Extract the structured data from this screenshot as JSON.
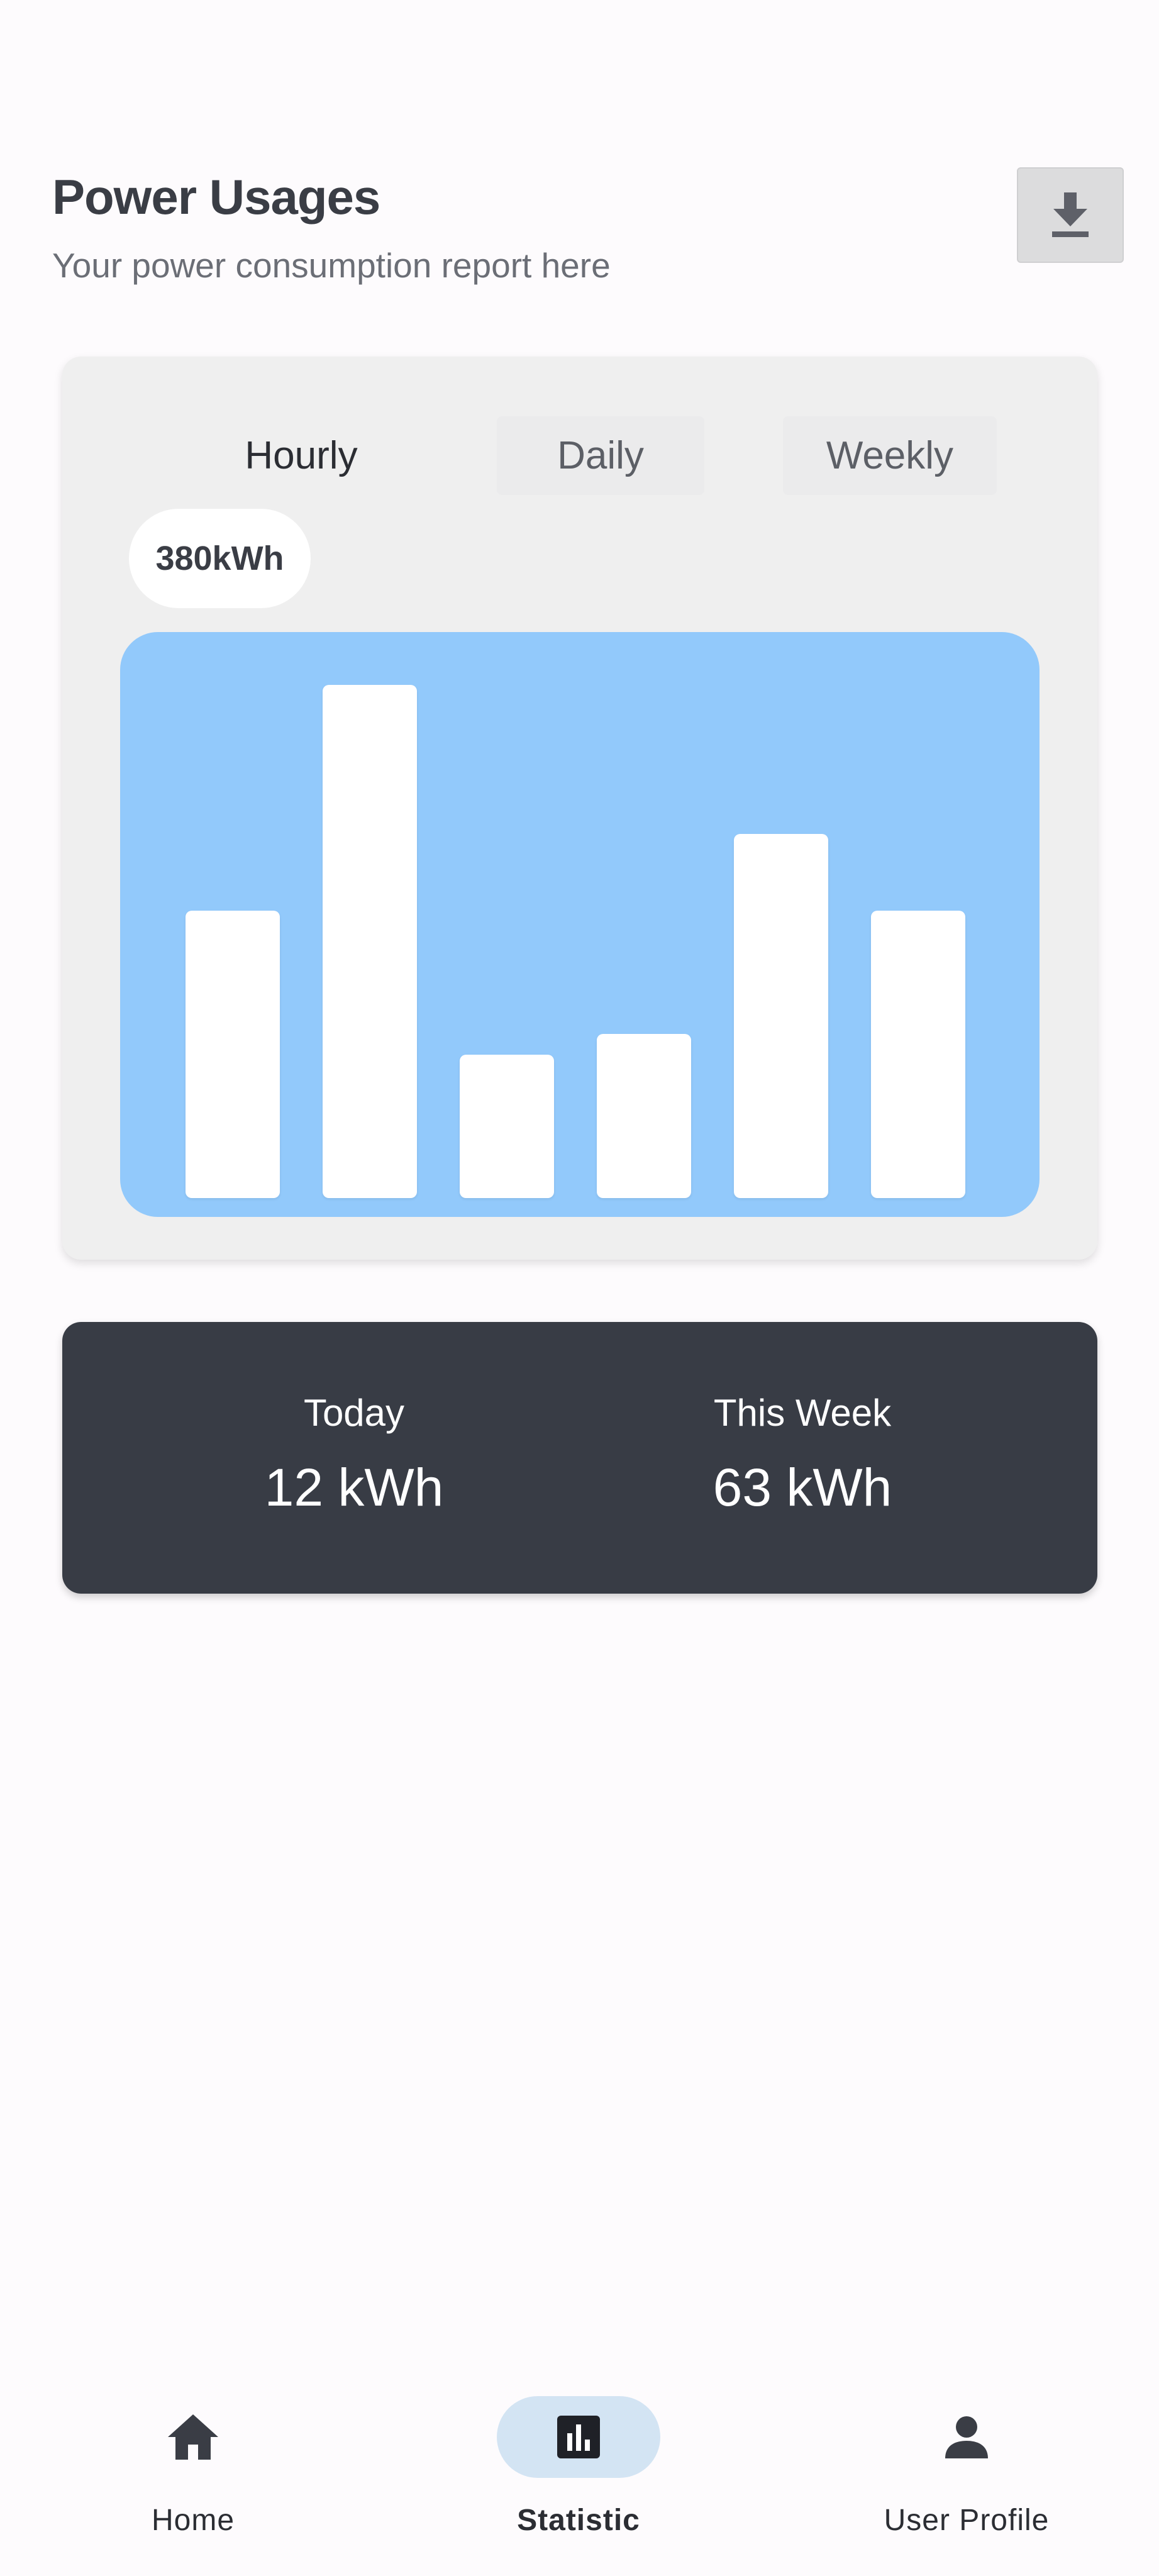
{
  "header": {
    "title": "Power Usages",
    "subtitle": "Your power consumption report here",
    "download_icon": "download-icon"
  },
  "chart_card": {
    "tabs": [
      {
        "label": "Hourly",
        "active": true
      },
      {
        "label": "Daily",
        "active": false
      },
      {
        "label": "Weekly",
        "active": false
      }
    ],
    "selected_value": "380kWh"
  },
  "chart_data": {
    "type": "bar",
    "categories": [
      "",
      "",
      "",
      "",
      "",
      ""
    ],
    "values": [
      0.56,
      1.0,
      0.28,
      0.32,
      0.71,
      0.56
    ],
    "ylim": [
      0,
      1
    ],
    "title": "",
    "xlabel": "",
    "ylabel": "",
    "grid": false,
    "colors": {
      "background": "#92c9fb",
      "bar": "#ffffff"
    }
  },
  "stats": {
    "today_label": "Today",
    "today_value": "12 kWh",
    "week_label": "This Week",
    "week_value": "63 kWh"
  },
  "nav": {
    "items": [
      {
        "label": "Home",
        "icon": "home-icon",
        "active": false
      },
      {
        "label": "Statistic",
        "icon": "bar-chart-icon",
        "active": true
      },
      {
        "label": "User Profile",
        "icon": "user-icon",
        "active": false
      }
    ]
  },
  "colors": {
    "accent": "#92c9fb",
    "dark_card": "#383c45",
    "nav_active": "#d3e4f3"
  }
}
